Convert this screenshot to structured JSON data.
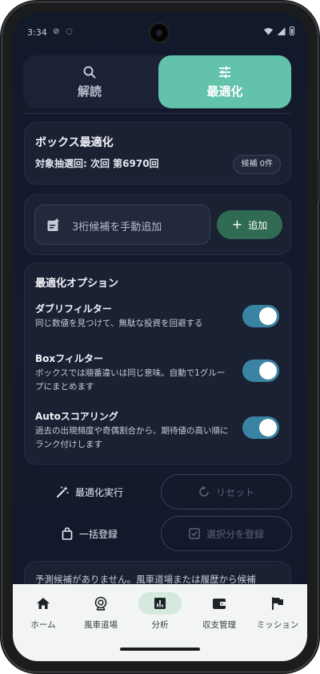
{
  "status": {
    "time": "3:34"
  },
  "tabs": [
    {
      "label": "解読",
      "icon": "search-icon",
      "active": false
    },
    {
      "label": "最適化",
      "icon": "tune-icon",
      "active": true
    }
  ],
  "box_card": {
    "title": "ボックス最適化",
    "subtitle": "対象抽選回: 次回 第6970回",
    "candidates_badge": "候補 0件"
  },
  "manual_add": {
    "placeholder_label": "3桁候補を手動追加",
    "add_button": "追加"
  },
  "options": {
    "title": "最適化オプション",
    "items": [
      {
        "name": "ダブリフィルター",
        "desc": "同じ数値を見つけて、無駄な投資を回避する",
        "enabled": true
      },
      {
        "name": "Boxフィルター",
        "desc": "ボックスでは順番違いは同じ意味。自動で1グループにまとめます",
        "enabled": true
      },
      {
        "name": "Autoスコアリング",
        "desc": "過去の出現頻度や奇偶割合から、期待値の高い順にランク付けします",
        "enabled": true
      }
    ]
  },
  "actions": {
    "run": "最適化実行",
    "reset": "リセット",
    "bulk_register": "一括登録",
    "register_selected": "選択分を登録"
  },
  "empty_message": "予測候補がありません。風車道場または履歴から候補",
  "bottom_nav": [
    {
      "label": "ホーム",
      "icon": "home-icon",
      "active": false
    },
    {
      "label": "風車道場",
      "icon": "windmill-icon",
      "active": false
    },
    {
      "label": "分析",
      "icon": "bar-chart-icon",
      "active": true
    },
    {
      "label": "収支管理",
      "icon": "wallet-icon",
      "active": false
    },
    {
      "label": "ミッション",
      "icon": "flag-icon",
      "active": false
    }
  ],
  "colors": {
    "accent": "#62c2aa",
    "toggle_on": "#3a83a2",
    "add_button": "#2f6b52",
    "background": "#12192b"
  }
}
